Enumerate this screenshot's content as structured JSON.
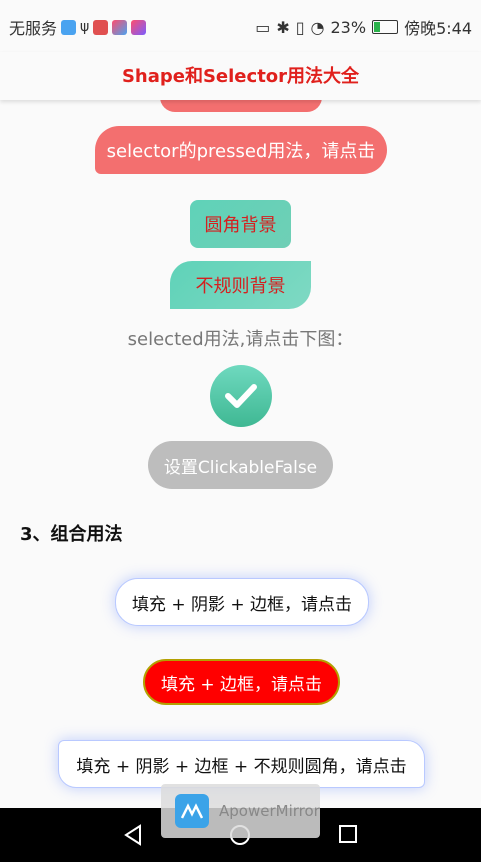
{
  "status_bar": {
    "carrier": "无服务",
    "battery": "23%",
    "time": "傍晚5:44"
  },
  "app_bar": {
    "title": "Shape和Selector用法大全"
  },
  "buttons": {
    "pressed": "selector的pressed用法，请点击",
    "round_bg": "圆角背景",
    "irregular_bg": "不规则背景",
    "selected_hint": "selected用法,请点击下图：",
    "clickable_false": "设置ClickableFalse"
  },
  "section3": {
    "title": "3、组合用法",
    "combo1": "填充 + 阴影 + 边框，请点击",
    "combo2": "填充 + 边框，请点击",
    "combo3": "填充 + 阴影 + 边框 + 不规则圆角，请点击"
  },
  "watermark": {
    "label": "ApowerMirror"
  },
  "colors": {
    "accent_red": "#e0201c",
    "pill_red": "#f36f6f",
    "teal": "#5fd2b8",
    "disabled": "#bdbdbd"
  }
}
